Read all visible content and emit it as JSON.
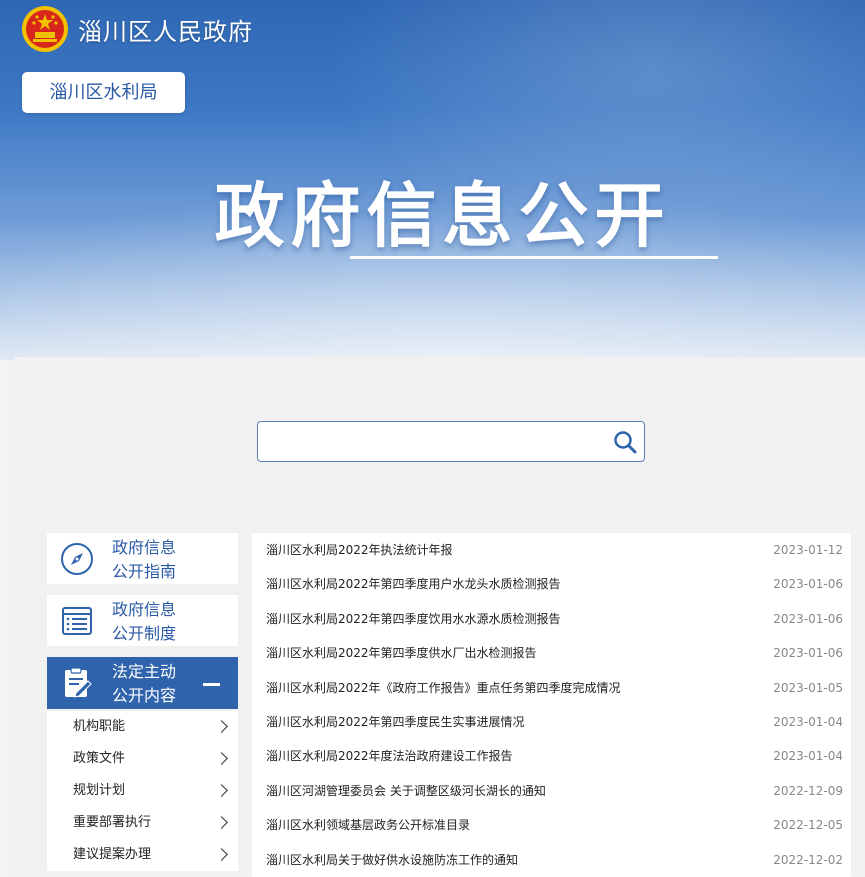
{
  "header": {
    "site_name": "淄川区人民政府",
    "bureau_button": "淄川区水利局",
    "big_title": "政府信息公开"
  },
  "search": {
    "placeholder": ""
  },
  "sidebar": {
    "cards": [
      {
        "label_line1": "政府信息",
        "label_line2": "公开指南",
        "icon": "compass-icon"
      },
      {
        "label_line1": "政府信息",
        "label_line2": "公开制度",
        "icon": "list-document-icon"
      },
      {
        "label_line1": "法定主动",
        "label_line2": "公开内容",
        "icon": "edit-clipboard-icon",
        "active": true
      }
    ],
    "submenu": [
      "机构职能",
      "政策文件",
      "规划计划",
      "重要部署执行",
      "建议提案办理"
    ]
  },
  "articles": [
    {
      "title": "淄川区水利局2022年执法统计年报",
      "date": "2023-01-12"
    },
    {
      "title": "淄川区水利局2022年第四季度用户水龙头水质检测报告",
      "date": "2023-01-06"
    },
    {
      "title": "淄川区水利局2022年第四季度饮用水水源水质检测报告",
      "date": "2023-01-06"
    },
    {
      "title": "淄川区水利局2022年第四季度供水厂出水检测报告",
      "date": "2023-01-06"
    },
    {
      "title": "淄川区水利局2022年《政府工作报告》重点任务第四季度完成情况",
      "date": "2023-01-05"
    },
    {
      "title": "淄川区水利局2022年第四季度民生实事进展情况",
      "date": "2023-01-04"
    },
    {
      "title": "淄川区水利局2022年度法治政府建设工作报告",
      "date": "2023-01-04"
    },
    {
      "title": "淄川区河湖管理委员会 关于调整区级河长湖长的通知",
      "date": "2022-12-09"
    },
    {
      "title": "淄川区水利领域基层政务公开标准目录",
      "date": "2022-12-05"
    },
    {
      "title": "淄川区水利局关于做好供水设施防冻工作的通知",
      "date": "2022-12-02"
    }
  ],
  "colors": {
    "brand_blue": "#2f64ad",
    "link_blue": "#2a5aa6",
    "date_gray": "#888888"
  }
}
